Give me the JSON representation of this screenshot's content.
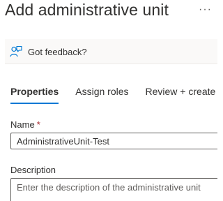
{
  "header": {
    "title": "Add administrative unit",
    "more_label": "···"
  },
  "command_bar": {
    "feedback_icon": "feedback-person-icon",
    "feedback_label": "Got feedback?"
  },
  "tabs": [
    {
      "label": "Properties",
      "active": true
    },
    {
      "label": "Assign roles",
      "active": false
    },
    {
      "label": "Review + create",
      "active": false
    }
  ],
  "form": {
    "name": {
      "label": "Name",
      "required_marker": "*",
      "value": "AdministrativeUnit-Test"
    },
    "description": {
      "label": "Description",
      "value": "",
      "placeholder": "Enter the description of the administrative unit"
    }
  },
  "colors": {
    "accent": "#0078d4",
    "required": "#a4262c",
    "command_bar_bg": "#faf9f8"
  }
}
